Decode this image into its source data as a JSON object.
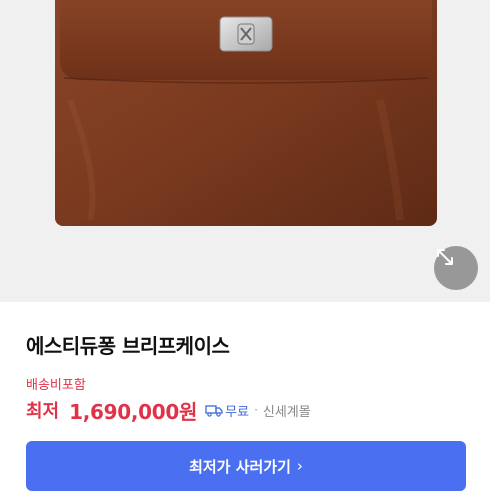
{
  "product": {
    "title": "에스티듀퐁 브리프케이스",
    "shipping_note": "배송비포함",
    "price_prefix": "최저",
    "price": "1,690,000원",
    "shipping_label": "무료",
    "separator": "·",
    "seller": "신세계몰"
  },
  "cta": {
    "label": "최저가 사러가기",
    "chevron": "›"
  },
  "icons": {
    "expand": "expand-icon",
    "shipping": "truck-icon",
    "chevron": "chevron-right-icon"
  },
  "colors": {
    "accent_red": "#e0334a",
    "cta_blue": "#4a6ff0",
    "shipping_blue": "#3d6bd8",
    "leather": "#7a3a1f"
  }
}
